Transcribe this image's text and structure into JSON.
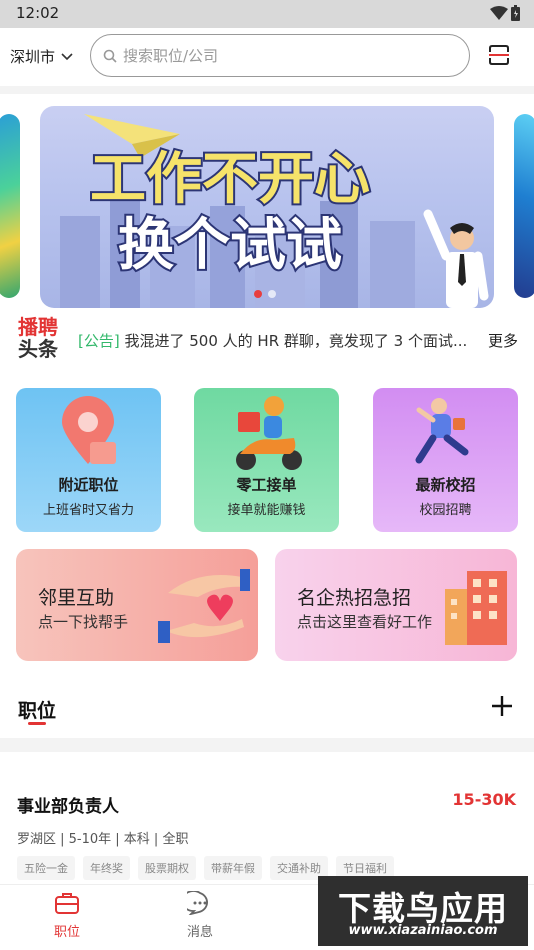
{
  "status": {
    "time": "12:02"
  },
  "topbar": {
    "city": "深圳市",
    "search_placeholder": "搜索职位/公司"
  },
  "banner": {
    "line1": "工作不开心",
    "line2": "换个试试",
    "active_index": 0,
    "count": 2
  },
  "headline": {
    "logo_line1": "播聘",
    "logo_line2": "头条",
    "tag": "[公告]",
    "text": "我混进了 500 人的 HR 群聊，竟发现了 3 个面试...",
    "more": "更多"
  },
  "quick_cards": [
    {
      "title": "附近职位",
      "sub": "上班省时又省力"
    },
    {
      "title": "零工接单",
      "sub": "接单就能赚钱"
    },
    {
      "title": "最新校招",
      "sub": "校园招聘"
    }
  ],
  "big_cards": [
    {
      "title": "邻里互助",
      "sub": "点一下找帮手"
    },
    {
      "title": "名企热招急招",
      "sub": "点击这里查看好工作"
    }
  ],
  "jobs_section": {
    "label": "职位"
  },
  "job": {
    "title": "事业部负责人",
    "salary": "15-30K",
    "meta": "罗湖区 | 5-10年 | 本科 | 全职",
    "tags": [
      "五险一金",
      "年终奖",
      "股票期权",
      "带薪年假",
      "交通补助",
      "节日福利"
    ]
  },
  "tabbar": {
    "tabs": [
      {
        "label": "职位",
        "active": true
      },
      {
        "label": "消息",
        "active": false
      }
    ]
  },
  "watermark": {
    "line1": "下载鸟应用",
    "line2": "www.xiazainiao.com"
  },
  "colors": {
    "accent": "#e23434",
    "green_tag": "#33b86b"
  }
}
